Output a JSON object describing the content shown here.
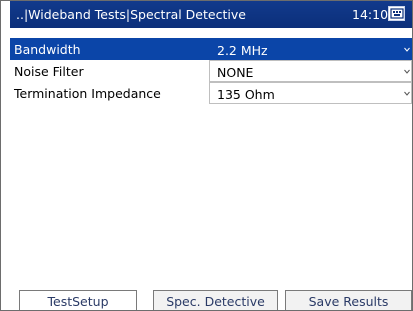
{
  "window": {
    "title": "..|Wideband Tests|Spectral Detective",
    "time": "14:10",
    "icon": "keypad-icon"
  },
  "settings": [
    {
      "label": "Bandwidth",
      "value": "2.2 MHz",
      "selected": true
    },
    {
      "label": "Noise Filter",
      "value": "NONE",
      "selected": false
    },
    {
      "label": "Termination Impedance",
      "value": "135 Ohm",
      "selected": false
    }
  ],
  "tabs": [
    {
      "label": "TestSetup",
      "active": true
    },
    {
      "label": "Spec. Detective",
      "active": false
    },
    {
      "label": "Save Results",
      "active": false
    }
  ],
  "colors": {
    "titlebar": "#0b2f7a",
    "selection": "#0b45a8"
  }
}
